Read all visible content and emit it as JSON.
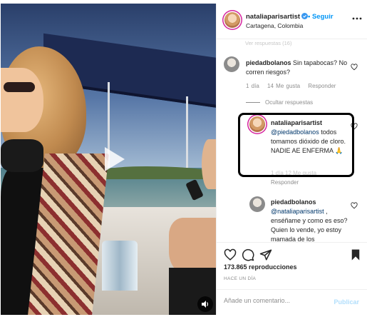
{
  "post": {
    "username": "nataliaparisartist",
    "verified": true,
    "follow_label": "Seguir",
    "location": "Cartagena, Colombia"
  },
  "comments": {
    "faded_top": "Ver respuestas (16)",
    "first": {
      "username": "piedadbolanos",
      "text": " Sin tapabocas? No corren riesgos?",
      "time": "1 día",
      "likes": "14 Me gusta",
      "reply_label": "Responder",
      "hide_replies": "Ocultar respuestas"
    },
    "reply1": {
      "username": "nataliaparisartist",
      "mention": "@piedadbolanos",
      "text": " todos tomamos dióxido de cloro. NADIE AE ENFERMA 🙏",
      "meta": "1 día  12 Me gusta",
      "reply_label": "Responder"
    },
    "reply2": {
      "username": "piedadbolanos",
      "mention": "@nataliaparisartist",
      "text": " , enséñame y como es eso? Quien lo vende, yo estoy mamada de los"
    }
  },
  "stats": {
    "views": "173.865 reproducciones",
    "time_ago": "HACE UN DÍA"
  },
  "composer": {
    "placeholder": "Añade un comentario...",
    "publish_label": "Publicar"
  },
  "icons": {
    "play": "play-icon",
    "audio": "speaker-icon",
    "like": "heart-icon",
    "comment": "comment-icon",
    "share": "paper-plane-icon",
    "save": "bookmark-icon",
    "more": "more-options-icon"
  },
  "colors": {
    "link_blue": "#0095f6",
    "secondary_text": "#8e8e8e",
    "highlight_box": "#000000"
  }
}
